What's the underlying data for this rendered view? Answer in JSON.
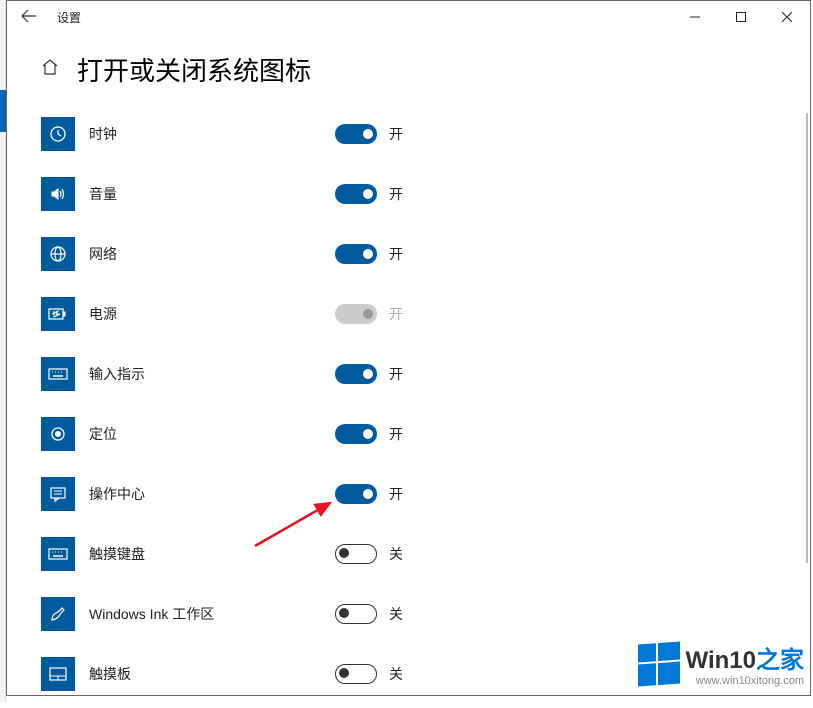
{
  "titlebar": {
    "title": "设置"
  },
  "header": {
    "page_title": "打开或关闭系统图标"
  },
  "rows": [
    {
      "icon": "clock",
      "label": "时钟",
      "state": "on",
      "state_label": "开"
    },
    {
      "icon": "volume",
      "label": "音量",
      "state": "on",
      "state_label": "开"
    },
    {
      "icon": "network",
      "label": "网络",
      "state": "on",
      "state_label": "开"
    },
    {
      "icon": "power",
      "label": "电源",
      "state": "disabled",
      "state_label": "开"
    },
    {
      "icon": "input",
      "label": "输入指示",
      "state": "on",
      "state_label": "开"
    },
    {
      "icon": "location",
      "label": "定位",
      "state": "on",
      "state_label": "开"
    },
    {
      "icon": "action-center",
      "label": "操作中心",
      "state": "on",
      "state_label": "开"
    },
    {
      "icon": "touch-keyboard",
      "label": "触摸键盘",
      "state": "off",
      "state_label": "关"
    },
    {
      "icon": "ink",
      "label": "Windows Ink 工作区",
      "state": "off",
      "state_label": "关"
    },
    {
      "icon": "touchpad",
      "label": "触摸板",
      "state": "off",
      "state_label": "关"
    }
  ],
  "watermark": {
    "brand_main": "Win10",
    "brand_suffix": "之家",
    "url": "www.win10xitong.com"
  }
}
